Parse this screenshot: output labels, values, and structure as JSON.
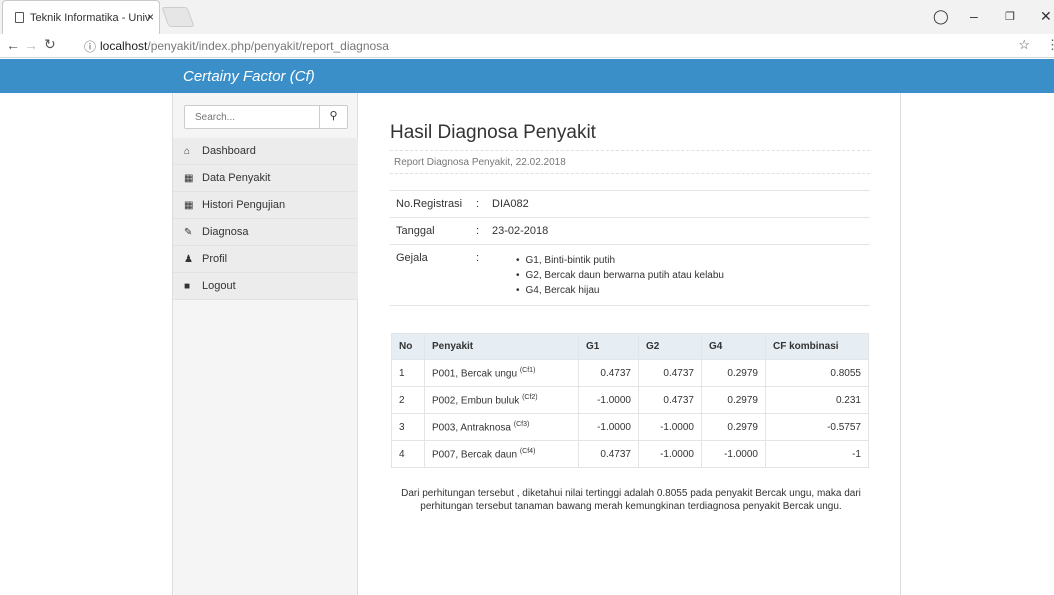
{
  "browser": {
    "tab_title": "Teknik Informatika - Univ",
    "tab_close": "×",
    "url_host": "localhost",
    "url_path": "/penyakit/index.php/penyakit/report_diagnosa"
  },
  "header": {
    "brand": "Certainy Factor (Cf)"
  },
  "sidebar": {
    "search_placeholder": "Search...",
    "items": [
      {
        "label": "Dashboard",
        "icon": "home-icon"
      },
      {
        "label": "Data Penyakit",
        "icon": "grid-icon"
      },
      {
        "label": "Histori Pengujian",
        "icon": "grid-icon"
      },
      {
        "label": "Diagnosa",
        "icon": "pencil-icon"
      },
      {
        "label": "Profil",
        "icon": "user-icon"
      },
      {
        "label": "Logout",
        "icon": "lock-icon"
      }
    ]
  },
  "main": {
    "title": "Hasil Diagnosa Penyakit",
    "subtitle": "Report Diagnosa Penyakit, 22.02.2018",
    "info": {
      "reg_label": "No.Registrasi",
      "reg_value": "DIA082",
      "date_label": "Tanggal",
      "date_value": "23-02-2018",
      "gejala_label": "Gejala",
      "sep": ":",
      "gejala": [
        "G1, Binti-bintik putih",
        "G2, Bercak daun berwarna putih atau kelabu",
        "G4, Bercak hijau"
      ]
    },
    "table": {
      "headers": [
        "No",
        "Penyakit",
        "G1",
        "G2",
        "G4",
        "CF kombinasi"
      ],
      "rows": [
        {
          "no": "1",
          "penyakit": "P001, Bercak ungu",
          "sup": "(Cf1)",
          "g1": "0.4737",
          "g2": "0.4737",
          "g4": "0.2979",
          "cf": "0.8055"
        },
        {
          "no": "2",
          "penyakit": "P002, Embun buluk",
          "sup": "(Cf2)",
          "g1": "-1.0000",
          "g2": "0.4737",
          "g4": "0.2979",
          "cf": "0.231"
        },
        {
          "no": "3",
          "penyakit": "P003, Antraknosa",
          "sup": "(Cf3)",
          "g1": "-1.0000",
          "g2": "-1.0000",
          "g4": "0.2979",
          "cf": "-0.5757"
        },
        {
          "no": "4",
          "penyakit": "P007, Bercak daun",
          "sup": "(Cf4)",
          "g1": "0.4737",
          "g2": "-1.0000",
          "g4": "-1.0000",
          "cf": "-1"
        }
      ]
    },
    "note": "Dari perhitungan tersebut , diketahui nilai tertinggi adalah 0.8055 pada penyakit Bercak ungu, maka dari perhitungan tersebut tanaman bawang merah kemungkinan terdiagnosa penyakit Bercak ungu."
  },
  "colors": {
    "nav": "#3a8fc9",
    "sidebar": "#f5f5f5",
    "table_header": "#e6eef3"
  }
}
